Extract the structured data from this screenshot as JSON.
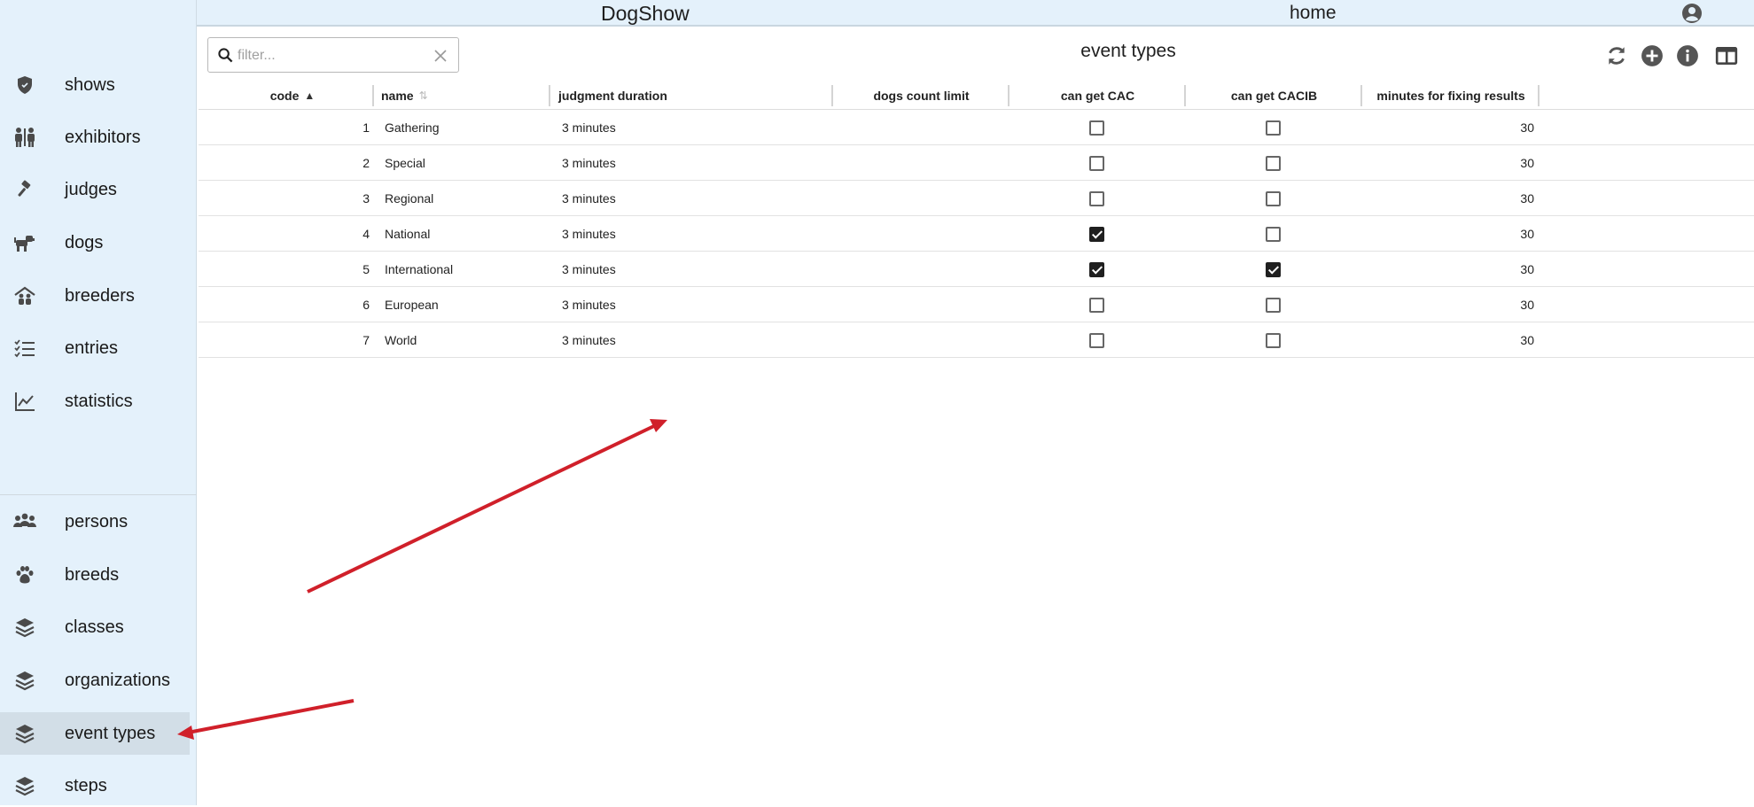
{
  "app": {
    "title": "DogShow",
    "home": "home"
  },
  "sidebar": {
    "items": [
      {
        "label": "shows",
        "icon": "shield-icon"
      },
      {
        "label": "exhibitors",
        "icon": "people-icon"
      },
      {
        "label": "judges",
        "icon": "gavel-icon"
      },
      {
        "label": "dogs",
        "icon": "dog-icon"
      },
      {
        "label": "breeders",
        "icon": "breeders-icon"
      },
      {
        "label": "entries",
        "icon": "checklist-icon"
      },
      {
        "label": "statistics",
        "icon": "chart-line-icon"
      },
      {
        "label": "persons",
        "icon": "group-icon"
      },
      {
        "label": "breeds",
        "icon": "paw-icon"
      },
      {
        "label": "classes",
        "icon": "layers-icon"
      },
      {
        "label": "organizations",
        "icon": "layers-icon"
      },
      {
        "label": "event types",
        "icon": "layers-icon",
        "active": true
      },
      {
        "label": "steps",
        "icon": "layers-icon"
      }
    ]
  },
  "filter": {
    "placeholder": "filter...",
    "value": ""
  },
  "page": {
    "title": "event types"
  },
  "toolbar": {
    "refresh": "refresh-icon",
    "add": "add-icon",
    "info": "info-icon",
    "columns": "columns-icon"
  },
  "table": {
    "columns": [
      {
        "label": "code",
        "sort": "asc"
      },
      {
        "label": "name",
        "sort": "none"
      },
      {
        "label": "judgment duration"
      },
      {
        "label": "dogs count limit"
      },
      {
        "label": "can get CAC"
      },
      {
        "label": "can get CACIB"
      },
      {
        "label": "minutes for fixing results"
      }
    ],
    "rows": [
      {
        "code": "1",
        "name": "Gathering",
        "duration": "3 minutes",
        "limit": "",
        "cac": false,
        "cacib": false,
        "minutes": "30"
      },
      {
        "code": "2",
        "name": "Special",
        "duration": "3 minutes",
        "limit": "",
        "cac": false,
        "cacib": false,
        "minutes": "30"
      },
      {
        "code": "3",
        "name": "Regional",
        "duration": "3 minutes",
        "limit": "",
        "cac": false,
        "cacib": false,
        "minutes": "30"
      },
      {
        "code": "4",
        "name": "National",
        "duration": "3 minutes",
        "limit": "",
        "cac": true,
        "cacib": false,
        "minutes": "30"
      },
      {
        "code": "5",
        "name": "International",
        "duration": "3 minutes",
        "limit": "",
        "cac": true,
        "cacib": true,
        "minutes": "30"
      },
      {
        "code": "6",
        "name": "European",
        "duration": "3 minutes",
        "limit": "",
        "cac": false,
        "cacib": false,
        "minutes": "30"
      },
      {
        "code": "7",
        "name": "World",
        "duration": "3 minutes",
        "limit": "",
        "cac": false,
        "cacib": false,
        "minutes": "30"
      }
    ]
  },
  "colors": {
    "sidebar_bg": "#e4f1fb",
    "active_bg": "#d2dee7",
    "arrow": "#d0202a"
  }
}
